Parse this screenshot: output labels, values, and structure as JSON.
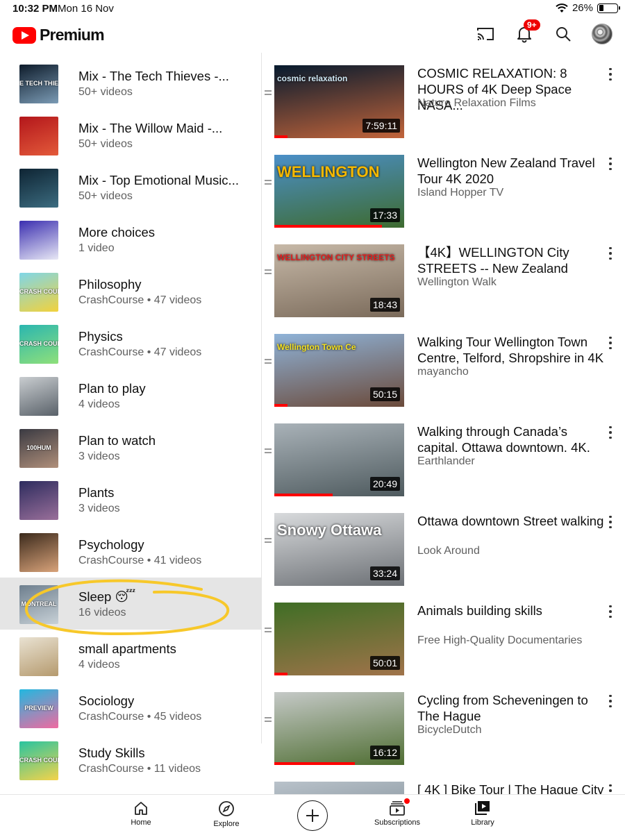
{
  "status_bar": {
    "time": "10:32 PM",
    "date": "Mon 16 Nov",
    "battery": "26%"
  },
  "app_bar": {
    "logo_text": "Premium",
    "notification_badge": "9+"
  },
  "playlists": [
    {
      "title": "Mix - The Tech Thieves -...",
      "subtitle": "50+ videos",
      "thumb_colors": [
        "#0d1b2a",
        "#7b9bb5"
      ],
      "thumb_text": "E TECH THIEV"
    },
    {
      "title": "Mix - The Willow Maid -...",
      "subtitle": "50+ videos",
      "thumb_colors": [
        "#b3161b",
        "#e35a3a"
      ],
      "thumb_text": ""
    },
    {
      "title": "Mix - Top Emotional Music...",
      "subtitle": "50+ videos",
      "thumb_colors": [
        "#0e2433",
        "#3c6c80"
      ],
      "thumb_text": ""
    },
    {
      "title": "More choices",
      "subtitle": "1 video",
      "thumb_colors": [
        "#3b2fb0",
        "#e8e8f5"
      ],
      "thumb_text": ""
    },
    {
      "title": "Philosophy",
      "subtitle": "CrashCourse • 47 videos",
      "thumb_colors": [
        "#7fd6e8",
        "#f2d23c"
      ],
      "thumb_text": "CRASH COURSE"
    },
    {
      "title": "Physics",
      "subtitle": "CrashCourse • 47 videos",
      "thumb_colors": [
        "#2ab6b0",
        "#8fe07a"
      ],
      "thumb_text": "CRASH COURS"
    },
    {
      "title": "Plan to play",
      "subtitle": "4 videos",
      "thumb_colors": [
        "#c9cdd0",
        "#596169"
      ],
      "thumb_text": ""
    },
    {
      "title": "Plan to watch",
      "subtitle": "3 videos",
      "thumb_colors": [
        "#3a3a42",
        "#b08f7a"
      ],
      "thumb_text": "100HUM"
    },
    {
      "title": "Plants",
      "subtitle": "3 videos",
      "thumb_colors": [
        "#2d2c5e",
        "#9a6f9a"
      ],
      "thumb_text": ""
    },
    {
      "title": "Psychology",
      "subtitle": "CrashCourse • 41 videos",
      "thumb_colors": [
        "#3b2a1c",
        "#d9a37a"
      ],
      "thumb_text": ""
    },
    {
      "title": "Sleep 😴",
      "subtitle": "16 videos",
      "thumb_colors": [
        "#6e7f8e",
        "#c7d0d6"
      ],
      "thumb_text": "MONTREAL"
    },
    {
      "title": "small apartments",
      "subtitle": "4 videos",
      "thumb_colors": [
        "#e9e2d2",
        "#b59a6e"
      ],
      "thumb_text": ""
    },
    {
      "title": "Sociology",
      "subtitle": "CrashCourse • 45 videos",
      "thumb_colors": [
        "#22b8e0",
        "#f06aa0"
      ],
      "thumb_text": "PREVIEW"
    },
    {
      "title": "Study Skills",
      "subtitle": "CrashCourse • 11 videos",
      "thumb_colors": [
        "#29c4a0",
        "#f5d34a"
      ],
      "thumb_text": "CRASH COURSE"
    }
  ],
  "selected_playlist_index": 10,
  "videos": [
    {
      "title": "COSMIC RELAXATION: 8 HOURS of 4K Deep Space NASA...",
      "channel": "Nature Relaxation Films",
      "duration": "7:59:11",
      "progress": 0.1,
      "thumb_colors": [
        "#061a2e",
        "#c2643a"
      ],
      "overlay": "cosmic relaxation",
      "overlay_color": "#cfe8f5"
    },
    {
      "title": "Wellington New Zealand Travel Tour 4K 2020",
      "channel": "Island Hopper TV",
      "duration": "17:33",
      "progress": 0.83,
      "thumb_colors": [
        "#4b8fc8",
        "#3e6b2f"
      ],
      "overlay": "WELLINGTON",
      "overlay_color": "#f5b800"
    },
    {
      "title": "【4K】WELLINGTON City STREETS -- New Zealand",
      "channel": "Wellington Walk",
      "duration": "18:43",
      "progress": 0.0,
      "thumb_colors": [
        "#c7b9a8",
        "#7a6a5a"
      ],
      "overlay": "WELLINGTON CITY STREETS",
      "overlay_color": "#e02020"
    },
    {
      "title": "Walking Tour Wellington Town Centre, Telford, Shropshire in 4K",
      "channel": "mayancho",
      "duration": "50:15",
      "progress": 0.1,
      "thumb_colors": [
        "#8fb3d8",
        "#6b4a3a"
      ],
      "overlay": "Wellington Town Ce",
      "overlay_color": "#f3e020"
    },
    {
      "title": "Walking through Canada’s capital. Ottawa downtown. 4K.",
      "channel": "Earthlander",
      "duration": "20:49",
      "progress": 0.45,
      "thumb_colors": [
        "#a9b2b8",
        "#4e5a5e"
      ],
      "overlay": "",
      "overlay_color": "#ffffff"
    },
    {
      "title": "Ottawa downtown Street walking",
      "channel": "Look Around",
      "duration": "33:24",
      "progress": 0.0,
      "thumb_colors": [
        "#d8dadc",
        "#6c7075"
      ],
      "overlay": "Snowy Ottawa",
      "overlay_color": "#ffffff"
    },
    {
      "title": "Animals building skills",
      "channel": "Free High-Quality Documentaries",
      "duration": "50:01",
      "progress": 0.1,
      "thumb_colors": [
        "#3f6e25",
        "#a0734a"
      ],
      "overlay": "",
      "overlay_color": "#ffffff"
    },
    {
      "title": "Cycling from Scheveningen to The Hague",
      "channel": "BicycleDutch",
      "duration": "16:12",
      "progress": 0.62,
      "thumb_colors": [
        "#c5c9c7",
        "#4f6e32"
      ],
      "overlay": "",
      "overlay_color": "#ffffff"
    },
    {
      "title": "[ 4K ] Bike Tour | The Hague City",
      "channel": "",
      "duration": "",
      "progress": 0.0,
      "thumb_colors": [
        "#b9c2ca",
        "#6a7a84"
      ],
      "overlay": "",
      "overlay_color": "#ffffff"
    }
  ],
  "bottom_nav": {
    "home": "Home",
    "explore": "Explore",
    "subscriptions": "Subscriptions",
    "library": "Library"
  },
  "colors": {
    "brand_red": "#ff0000",
    "highlight_marker": "#f7c82a",
    "selected_row": "#e5e5e5"
  }
}
